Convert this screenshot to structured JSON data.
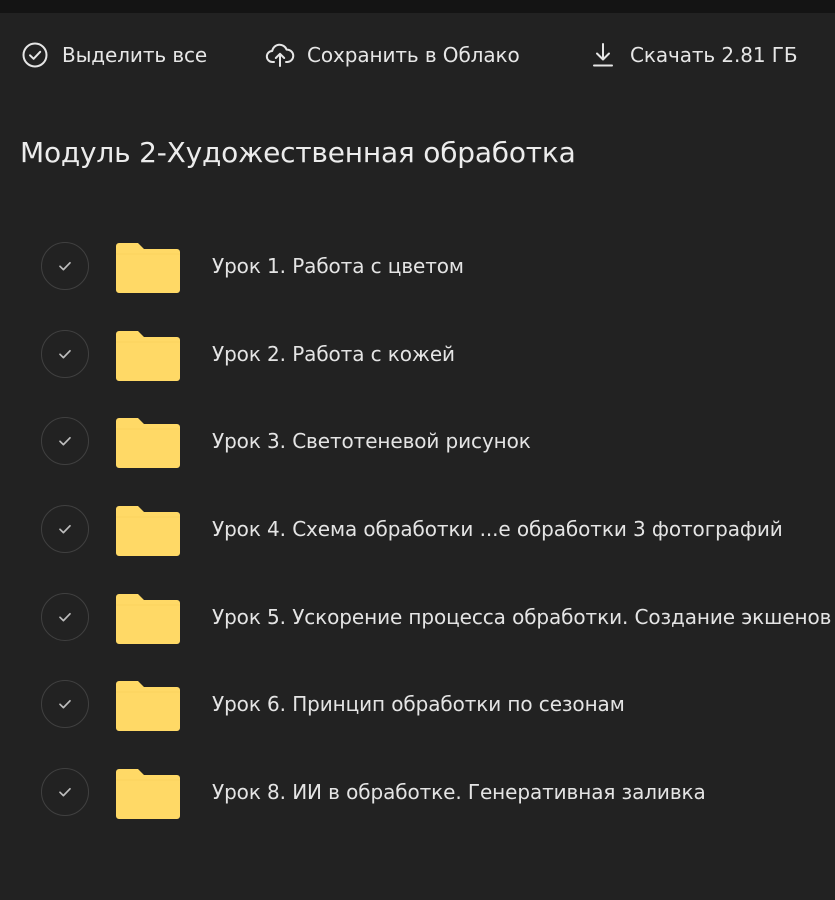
{
  "toolbar": {
    "select_all_label": "Выделить все",
    "save_to_cloud_label": "Сохранить в Облако",
    "download_label": "Скачать 2.81 ГБ"
  },
  "folder_title": "Модуль 2-Художественная обработка",
  "items": [
    {
      "name": "Урок 1. Работа с цветом"
    },
    {
      "name": "Урок 2. Работа с кожей"
    },
    {
      "name": "Урок 3. Светотеневой рисунок"
    },
    {
      "name": "Урок 4. Схема обработки ...е обработки 3 фотографий"
    },
    {
      "name": "Урок 5. Ускорение процесса обработки. Создание экшенов"
    },
    {
      "name": "Урок 6. Принцип обработки по сезонам"
    },
    {
      "name": "Урок 8. ИИ в обработке. Генеративная заливка"
    }
  ],
  "colors": {
    "background": "#222222",
    "folder": "#ffd966",
    "text": "#e6e6e6"
  }
}
